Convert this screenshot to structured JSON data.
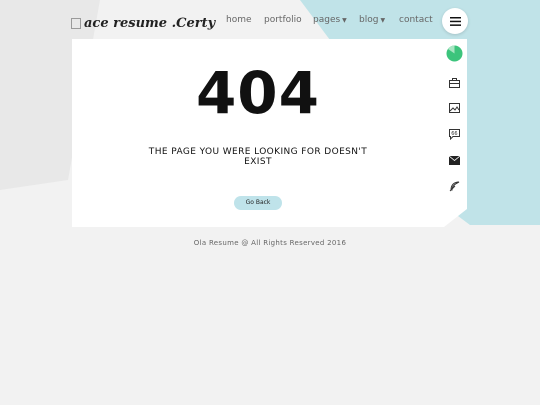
{
  "header": {
    "logo_text": "ace resume .Certy",
    "nav": [
      {
        "label": "home"
      },
      {
        "label": "portfolio"
      },
      {
        "label": "pages"
      },
      {
        "label": "blog"
      },
      {
        "label": "contact"
      }
    ]
  },
  "main": {
    "error_code": "404",
    "message_line1": "THE PAGE YOU WERE LOOKING FOR DOESN'T",
    "message_line2": "EXIST",
    "back_label": "Go Back"
  },
  "sidebar": {
    "icons": [
      "progress-icon",
      "briefcase-icon",
      "image-icon",
      "chat-icon",
      "envelope-icon",
      "feather-icon"
    ]
  },
  "footer": {
    "text": "Ola Resume @ All Rights Reserved 2016"
  },
  "colors": {
    "accent": "#bfe3ea",
    "progress": "#3cc47c",
    "background": "#f2f2f2"
  }
}
